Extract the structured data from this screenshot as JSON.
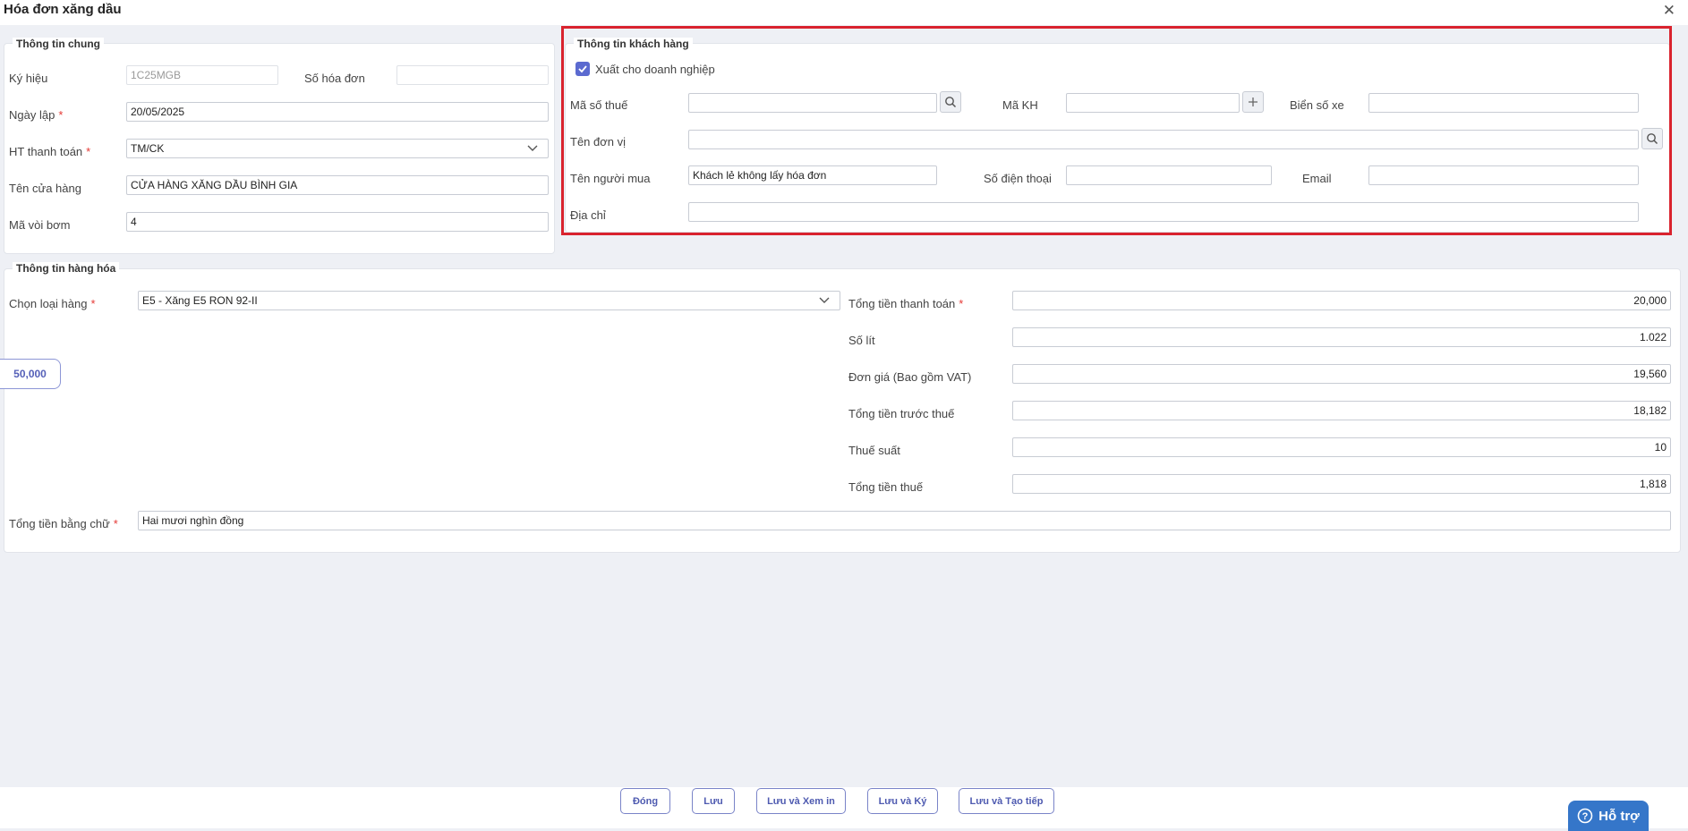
{
  "window": {
    "title": "Hóa đơn xăng dầu",
    "close_icon": "close-icon"
  },
  "general": {
    "legend": "Thông tin chung",
    "symbol": {
      "label": "Ký hiệu",
      "value": "1C25MGB"
    },
    "invoice_no": {
      "label": "Số hóa đơn",
      "value": ""
    },
    "date": {
      "label": "Ngày lập",
      "value": "20/05/2025"
    },
    "payment": {
      "label": "HT thanh toán",
      "value": "TM/CK"
    },
    "store": {
      "label": "Tên cửa hàng",
      "value": "CỬA HÀNG XĂNG DẦU BÌNH GIA"
    },
    "pump": {
      "label": "Mã vòi bơm",
      "value": "4"
    }
  },
  "customer": {
    "legend": "Thông tin khách hàng",
    "export_business": {
      "label": "Xuất cho doanh nghiệp",
      "checked": true
    },
    "tax_code": {
      "label": "Mã số thuế",
      "value": ""
    },
    "customer_code": {
      "label": "Mã KH",
      "value": ""
    },
    "plate": {
      "label": "Biển số xe",
      "value": ""
    },
    "unit_name": {
      "label": "Tên đơn vị",
      "value": ""
    },
    "buyer": {
      "label": "Tên người mua",
      "value": "Khách lẻ không lấy hóa đơn"
    },
    "phone": {
      "label": "Số điện thoại",
      "value": ""
    },
    "email": {
      "label": "Email",
      "value": ""
    },
    "address": {
      "label": "Địa chỉ",
      "value": ""
    }
  },
  "goods": {
    "legend": "Thông tin hàng hóa",
    "type": {
      "label": "Chọn loại hàng",
      "value": "E5 - Xăng E5 RON 92-II"
    },
    "quick_amount": "50,000",
    "total_payment": {
      "label": "Tổng tiền thanh toán",
      "value": "20,000"
    },
    "liters": {
      "label": "Số lít",
      "value": "1.022"
    },
    "unit_price": {
      "label": "Đơn giá (Bao gồm VAT)",
      "value": "19,560"
    },
    "pre_tax": {
      "label": "Tổng tiền trước thuế",
      "value": "18,182"
    },
    "tax_rate": {
      "label": "Thuế suất",
      "value": "10"
    },
    "tax_amount": {
      "label": "Tổng tiền thuế",
      "value": "1,818"
    },
    "in_words": {
      "label": "Tổng tiền bằng chữ",
      "value": "Hai mươi nghìn đồng"
    }
  },
  "footer": {
    "close": "Đóng",
    "save": "Lưu",
    "save_view": "Lưu và Xem in",
    "save_sign": "Lưu và Ký",
    "save_new": "Lưu và Tạo tiếp",
    "support": "Hỗ trợ"
  },
  "colors": {
    "accent": "#5b6ad0",
    "highlight": "#d9232e",
    "required": "#e53935",
    "support": "#3576c9"
  }
}
